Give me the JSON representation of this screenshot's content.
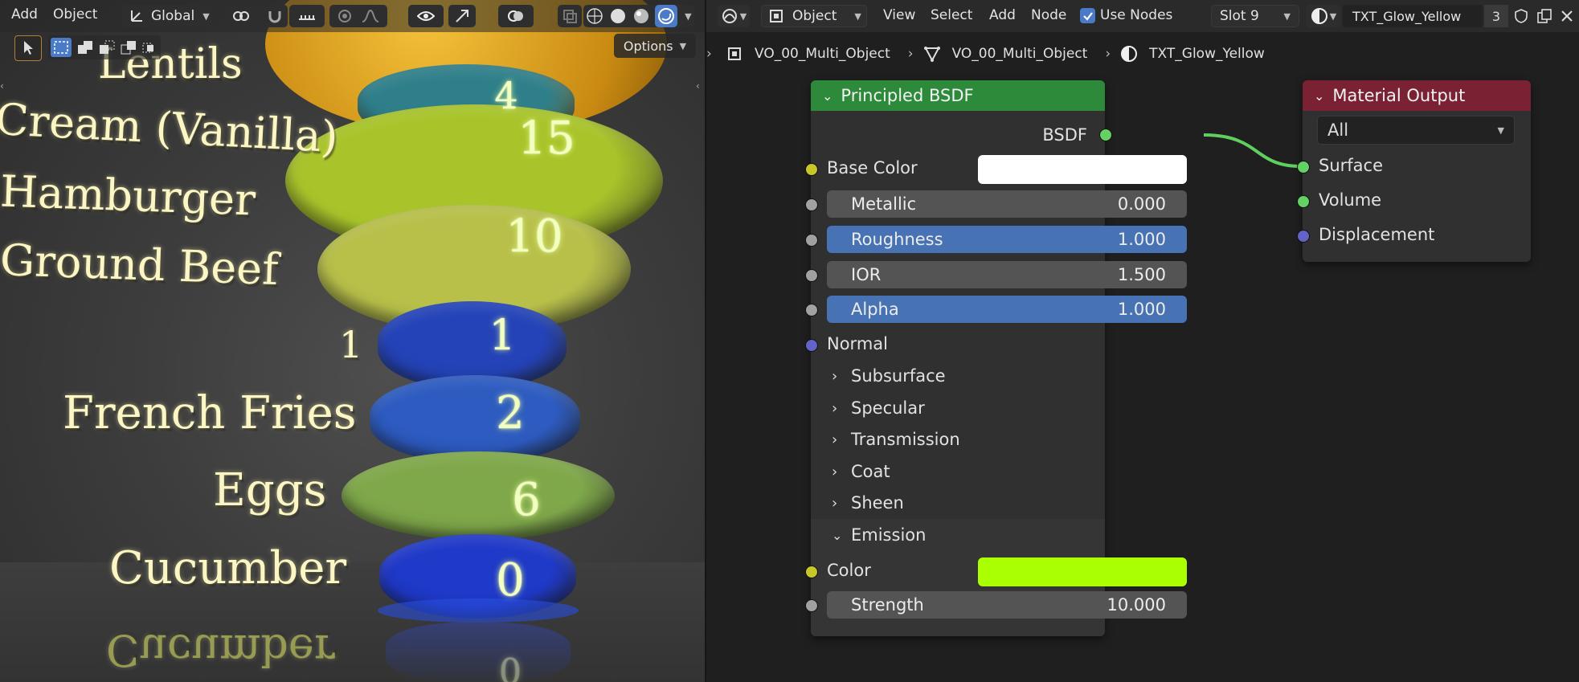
{
  "viewport": {
    "menu": [
      "Add",
      "Object"
    ],
    "transform_orientation": "Global",
    "options_label": "Options",
    "scene_labels": [
      {
        "text": "Lentils"
      },
      {
        "text": "Cream (Vanilla)"
      },
      {
        "text": "Hamburger"
      },
      {
        "text": "Ground Beef"
      },
      {
        "text": "French Fries"
      },
      {
        "text": "Eggs"
      },
      {
        "text": "Cucumber"
      },
      {
        "text": "Cucumber"
      }
    ],
    "stray_mark": "1",
    "stack_numbers": [
      "4",
      "15",
      "10",
      "1",
      "2",
      "6",
      "0",
      "0"
    ],
    "ring_colors": [
      "#2f7f8a",
      "#a8c42a",
      "#b8c04a",
      "#2443b8",
      "#2d5bc0",
      "#7fa84a",
      "#1f39c8"
    ]
  },
  "editor": {
    "header": {
      "object_mode": "Object",
      "menu": [
        "View",
        "Select",
        "Add",
        "Node"
      ],
      "use_nodes_label": "Use Nodes",
      "use_nodes_checked": true,
      "slot": "Slot 9",
      "material_name": "TXT_Glow_Yellow",
      "user_count": "3"
    },
    "breadcrumb": [
      "VO_00_Multi_Object",
      "VO_00_Multi_Object",
      "TXT_Glow_Yellow"
    ],
    "bsdf_node": {
      "title": "Principled BSDF",
      "output_label": "BSDF",
      "base_color_label": "Base Color",
      "base_color": "#ffffff",
      "fields": [
        {
          "label": "Metallic",
          "value": "0.000",
          "highlight": false
        },
        {
          "label": "Roughness",
          "value": "1.000",
          "highlight": true
        },
        {
          "label": "IOR",
          "value": "1.500",
          "highlight": false
        },
        {
          "label": "Alpha",
          "value": "1.000",
          "highlight": true
        }
      ],
      "normal_label": "Normal",
      "panels": [
        "Subsurface",
        "Specular",
        "Transmission",
        "Coat",
        "Sheen"
      ],
      "emission_panel": "Emission",
      "emission_color_label": "Color",
      "emission_color": "#aaff00",
      "strength_label": "Strength",
      "strength_value": "10.000"
    },
    "output_node": {
      "title": "Material Output",
      "target": "All",
      "inputs": [
        "Surface",
        "Volume",
        "Displacement"
      ]
    }
  }
}
